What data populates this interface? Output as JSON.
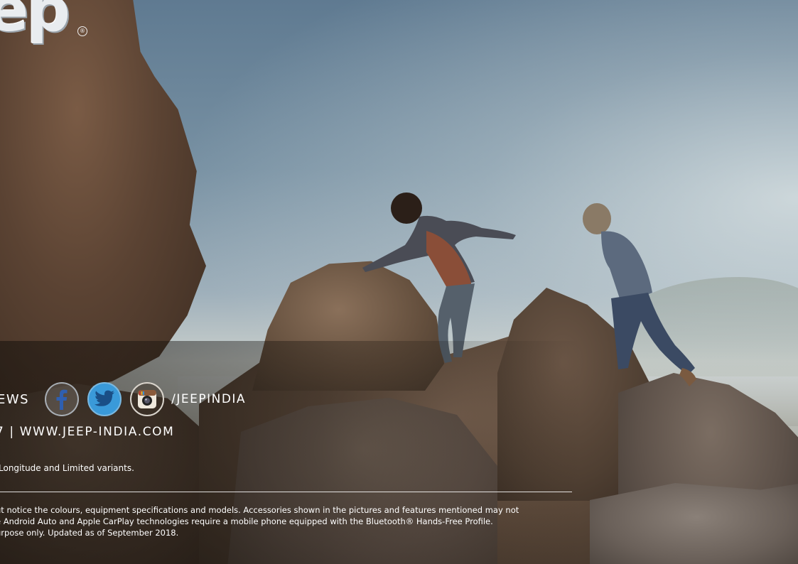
{
  "brand": {
    "logo_text": "Jeep",
    "registered_mark": "®"
  },
  "social": {
    "lead_text": "EWS",
    "icons": [
      "facebook-icon",
      "twitter-icon",
      "instagram-icon"
    ],
    "handle": "/JEEPINDIA",
    "colors": {
      "twitter": "#3a9ad9",
      "text": "#ffffff"
    }
  },
  "contact": {
    "line": "7 | WWW.JEEP-INDIA.COM"
  },
  "variant_note": "Longitude and Limited variants.",
  "disclaimer": {
    "lines": [
      "ut notice the colours, equipment specifications and models. Accessories shown in the pictures and features mentioned may not",
      "e Android Auto and Apple CarPlay technologies require a mobile phone equipped with the Bluetooth® Hands-Free Profile.",
      "urpose only. Updated as of September 2018."
    ]
  }
}
